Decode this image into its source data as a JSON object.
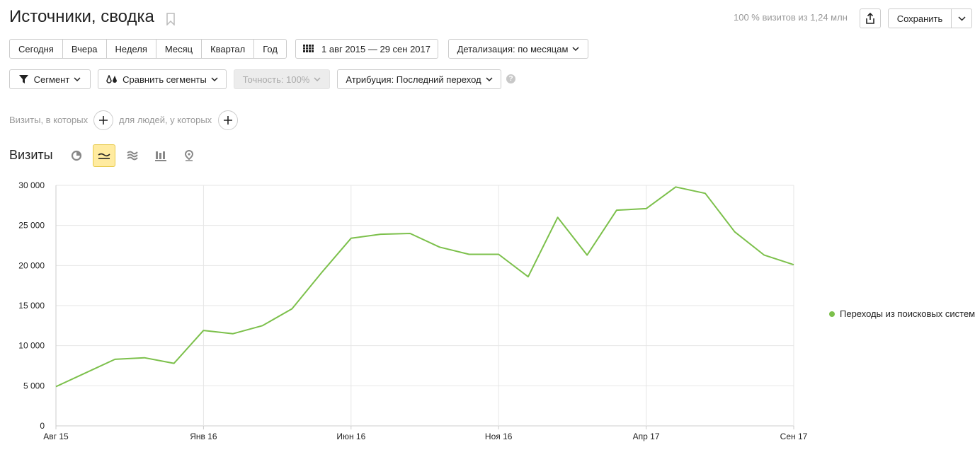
{
  "header": {
    "title": "Источники, сводка",
    "visits_info": "100 % визитов из 1,24 млн",
    "save_label": "Сохранить"
  },
  "period_buttons": [
    "Сегодня",
    "Вчера",
    "Неделя",
    "Месяц",
    "Квартал",
    "Год"
  ],
  "date_range": "1 авг 2015 — 29 сен 2017",
  "detail": "Детализация: по месяцам",
  "segment_label": "Сегмент",
  "compare_label": "Сравнить сегменты",
  "accuracy_label": "Точность: 100%",
  "attribution_label": "Атрибуция: Последний переход",
  "help_icon": "?",
  "filters": {
    "visits_where": "Визиты, в которых",
    "people_where": "для людей, у которых"
  },
  "metric_title": "Визиты",
  "icons": {
    "pie": "pie-chart-icon",
    "line": "line-chart-icon",
    "area": "stacked-area-icon",
    "bar": "bar-chart-icon",
    "map": "map-pin-icon"
  },
  "colors": {
    "series": "#7cc04b",
    "active_tab": "#ffeba0"
  },
  "chart_data": {
    "type": "line",
    "y_ticks": [
      "30 000",
      "25 000",
      "20 000",
      "15 000",
      "10 000",
      "5 000",
      "0"
    ],
    "x_tick_labels": [
      "Авг 15",
      "Янв 16",
      "Июн 16",
      "Ноя 16",
      "Апр 17",
      "Сен 17"
    ],
    "ylim": [
      0,
      30000
    ],
    "x": [
      "2015-08",
      "2015-09",
      "2015-10",
      "2015-11",
      "2015-12",
      "2016-01",
      "2016-02",
      "2016-03",
      "2016-04",
      "2016-05",
      "2016-06",
      "2016-07",
      "2016-08",
      "2016-09",
      "2016-10",
      "2016-11",
      "2016-12",
      "2017-01",
      "2017-02",
      "2017-03",
      "2017-04",
      "2017-05",
      "2017-06",
      "2017-07",
      "2017-08",
      "2017-09"
    ],
    "series": [
      {
        "name": "Переходы из поисковых систем",
        "values": [
          4900,
          6600,
          8300,
          8500,
          7800,
          11900,
          11500,
          12500,
          14600,
          19100,
          23400,
          23900,
          24000,
          22300,
          21400,
          21400,
          18600,
          26000,
          21300,
          26900,
          27100,
          29800,
          29000,
          24200,
          21300,
          20100
        ]
      }
    ],
    "grid": true,
    "legend_position": "right"
  }
}
